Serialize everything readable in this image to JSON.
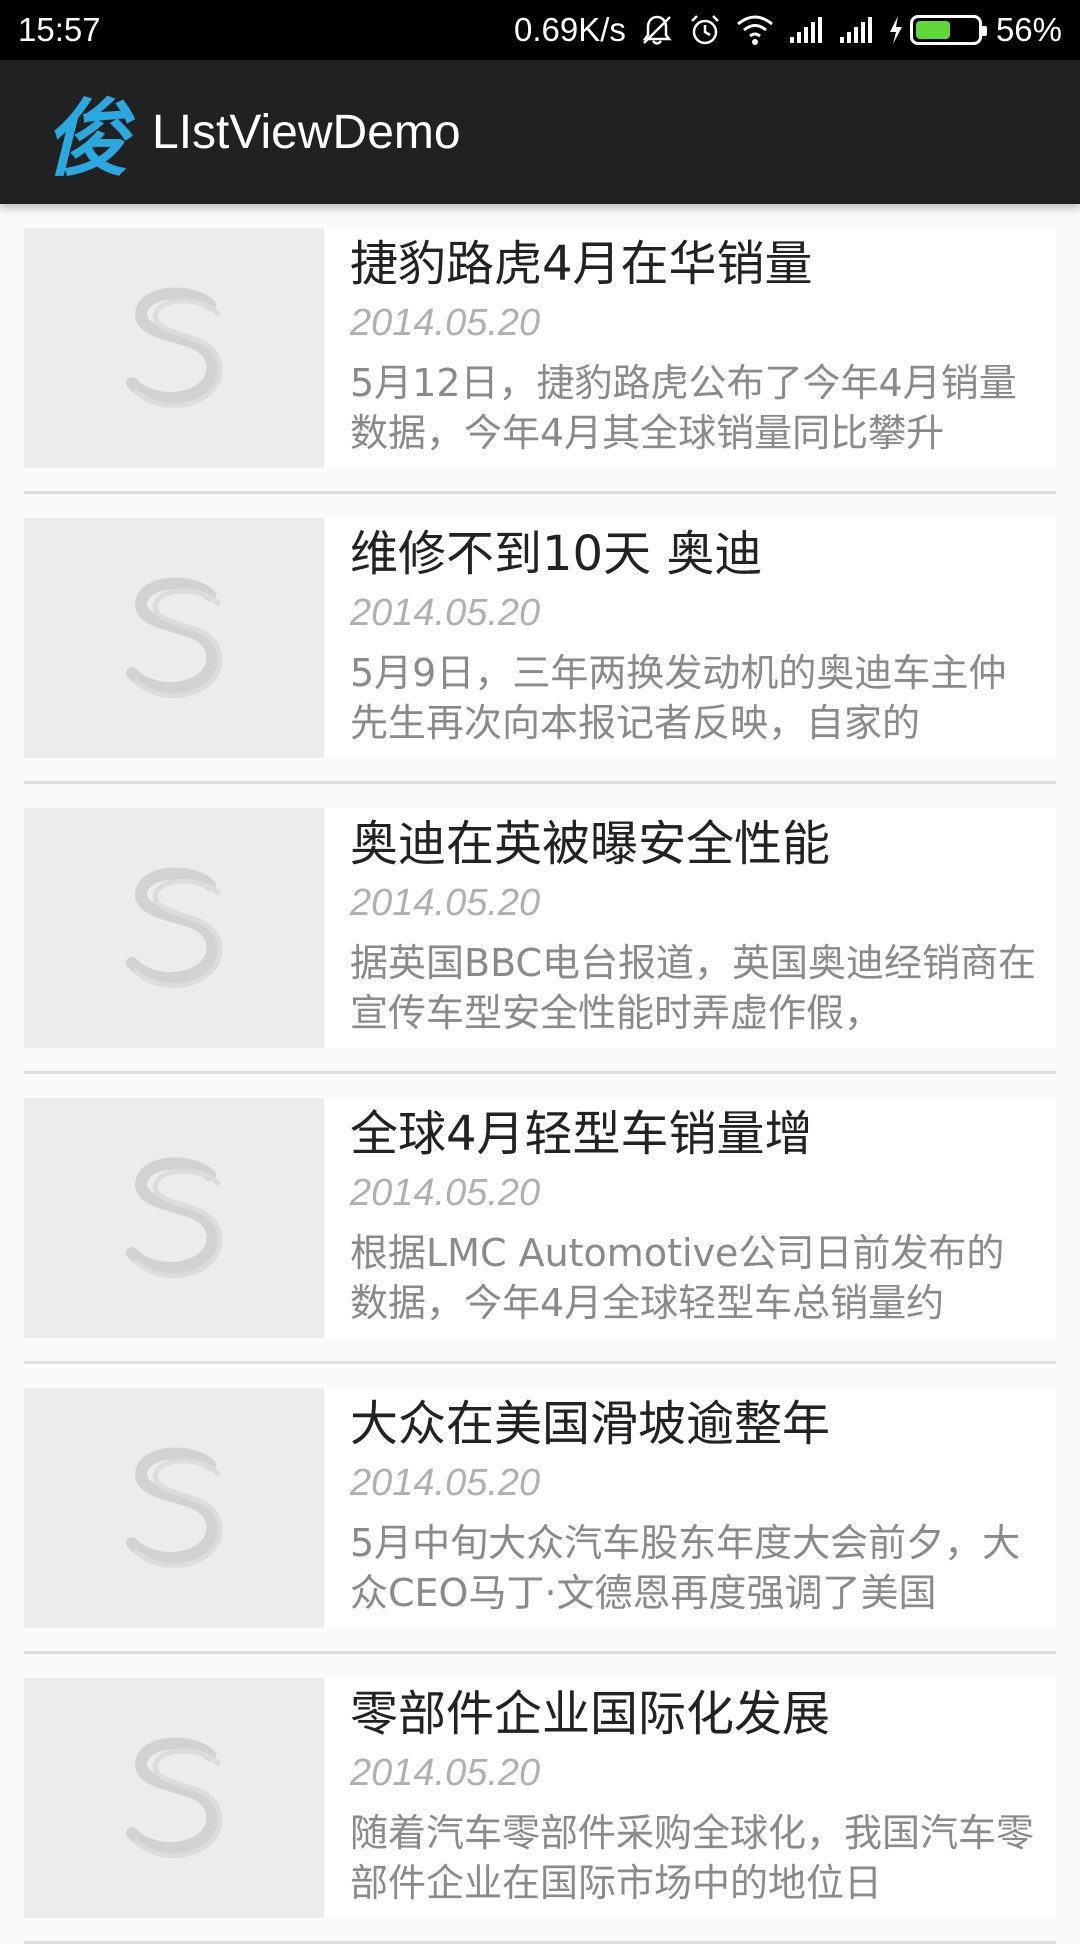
{
  "status_bar": {
    "time": "15:57",
    "speed": "0.69K/s",
    "icons": [
      "mute-bell-icon",
      "alarm-icon",
      "wifi-icon",
      "signal-icon",
      "signal-icon",
      "charging-icon",
      "battery-icon"
    ],
    "battery_percent": "56%",
    "battery_level": 0.56
  },
  "app_bar": {
    "logo_char": "俊",
    "title": "LIstViewDemo",
    "accent": "#29a9e0"
  },
  "list": {
    "items": [
      {
        "title": "捷豹路虎4月在华销量",
        "date": "2014.05.20",
        "desc": "5月12日，捷豹路虎公布了今年4月销量数据，今年4月其全球销量同比攀升"
      },
      {
        "title": "维修不到10天 奥迪",
        "date": "2014.05.20",
        "desc": " 5月9日，三年两换发动机的奥迪车主仲先生再次向本报记者反映，自家的"
      },
      {
        "title": "奥迪在英被曝安全性能",
        "date": "2014.05.20",
        "desc": "据英国BBC电台报道，英国奥迪经销商在宣传车型安全性能时弄虚作假，"
      },
      {
        "title": "全球4月轻型车销量增",
        "date": "2014.05.20",
        "desc": "根据LMC Automotive公司日前发布的数据，今年4月全球轻型车总销量约"
      },
      {
        "title": "大众在美国滑坡逾整年",
        "date": "2014.05.20",
        "desc": "5月中旬大众汽车股东年度大会前夕，大众CEO马丁·文德恩再度强调了美国"
      },
      {
        "title": "零部件企业国际化发展",
        "date": "2014.05.20",
        "desc": "随着汽车零部件采购全球化，我国汽车零部件企业在国际市场中的地位日"
      }
    ]
  }
}
